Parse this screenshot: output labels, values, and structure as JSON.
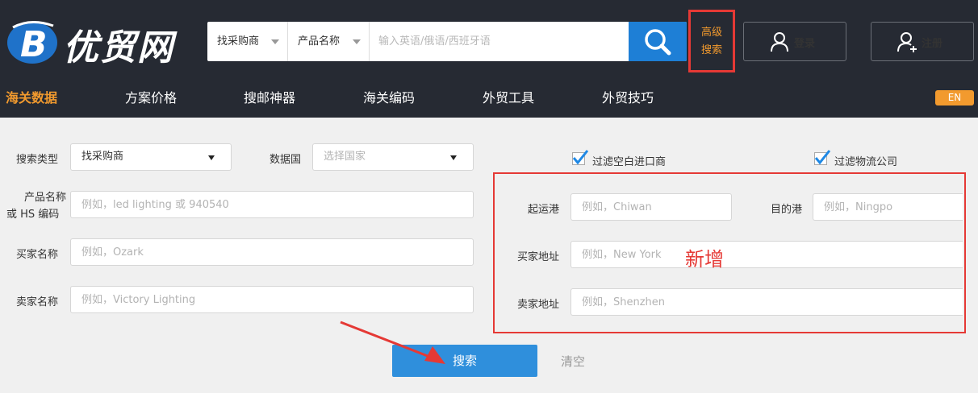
{
  "brand": {
    "logo_text": "优贸网"
  },
  "search": {
    "type_select": "找采购商",
    "field_select": "产品名称",
    "placeholder": "输入英语/俄语/西班牙语"
  },
  "advanced_search": {
    "line1": "高级",
    "line2": "搜索"
  },
  "account": {
    "login": "登录",
    "register": "注册"
  },
  "nav": {
    "items": [
      {
        "label": "海关数据",
        "active": true
      },
      {
        "label": "方案价格"
      },
      {
        "label": "搜邮神器"
      },
      {
        "label": "海关编码"
      },
      {
        "label": "外贸工具"
      },
      {
        "label": "外贸技巧"
      }
    ],
    "lang": "EN"
  },
  "form": {
    "search_type": {
      "label": "搜索类型",
      "value": "找采购商"
    },
    "data_country": {
      "label": "数据国",
      "placeholder": "选择国家"
    },
    "product": {
      "label_line1": "产品名称",
      "label_line2": "或 HS 编码",
      "placeholder": "例如，led lighting 或 940540"
    },
    "buyer": {
      "label": "买家名称",
      "placeholder": "例如，Ozark"
    },
    "seller": {
      "label": "卖家名称",
      "placeholder": "例如，Victory Lighting"
    },
    "filter_blank_importer": {
      "label": "过滤空白进口商",
      "checked": true
    },
    "filter_logistics": {
      "label": "过滤物流公司",
      "checked": true
    },
    "origin_port": {
      "label": "起运港",
      "placeholder": "例如，Chiwan"
    },
    "dest_port": {
      "label": "目的港",
      "placeholder": "例如，Ningpo"
    },
    "buyer_address": {
      "label": "买家地址",
      "placeholder": "例如，New York"
    },
    "seller_address": {
      "label": "卖家地址",
      "placeholder": "例如，Shenzhen"
    },
    "new_annotation": "新增",
    "submit": "搜索",
    "clear": "清空"
  },
  "colors": {
    "accent_orange": "#f29a2e",
    "annotation_red": "#e53935",
    "primary_blue": "#2f8fdc",
    "header_bg": "#262a33"
  }
}
